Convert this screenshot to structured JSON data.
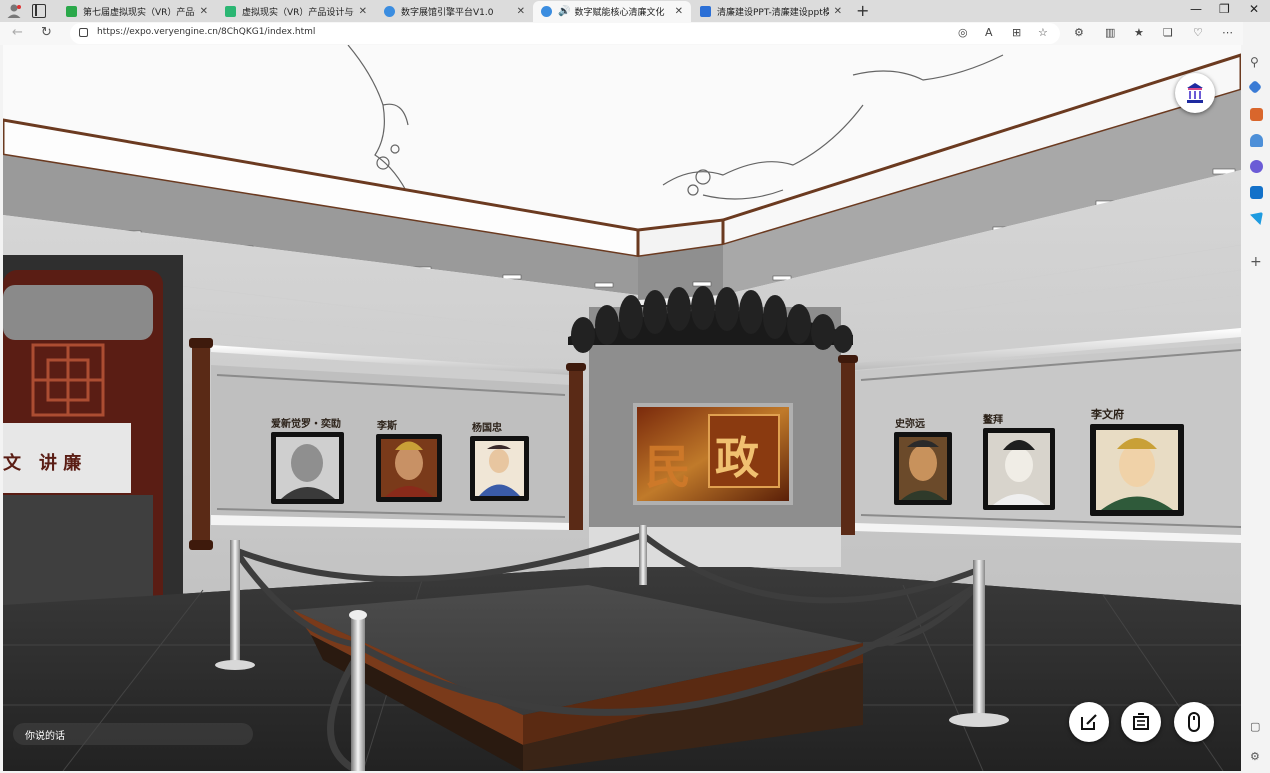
{
  "browser": {
    "tabs": [
      {
        "title": "第七届虚拟现实（VR）产品设计",
        "favicon_color": "#2aa84a",
        "active": false
      },
      {
        "title": "虚拟现实（VR）产品设计与开发",
        "favicon_color": "#2bb673",
        "active": false
      },
      {
        "title": "数字展馆引擎平台V1.0",
        "favicon_color": "#3b8de0",
        "active": false
      },
      {
        "title": "数字赋能核心清廉文化",
        "favicon_color": "#3b8de0",
        "active": true
      },
      {
        "title": "清廉建设PPT-清廉建设ppt模板下",
        "favicon_color": "#2b6fd6",
        "active": false
      }
    ],
    "url": "https://expo.veryengine.cn/8ChQKG1/index.html"
  },
  "exhibit": {
    "left_portraits": [
      "爱新觉罗・奕劻",
      "李斯",
      "杨国忠"
    ],
    "right_portraits": [
      "史弥远",
      "鳌拜",
      "李文府"
    ],
    "center_sign_chars": [
      "民",
      "政"
    ],
    "left_wall_sign": "讲 廉",
    "left_wall_sign_prefix": "文"
  },
  "overlay": {
    "chat_placeholder": "你说的话"
  },
  "icons": {
    "edit": "edit-icon",
    "board": "board-icon",
    "mouse": "mouse-icon",
    "logo": "temple-logo-icon"
  },
  "colors": {
    "accent": "#0f6cbd",
    "wood": "#5a2a16",
    "wall": "#e8e8e8"
  }
}
